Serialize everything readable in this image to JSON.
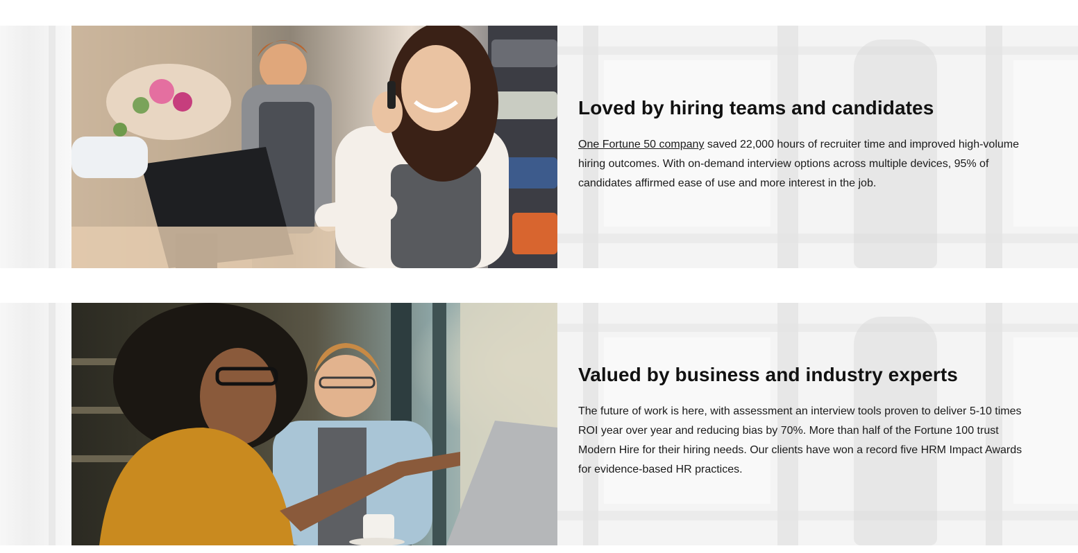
{
  "sections": [
    {
      "heading": "Loved by hiring teams and candidates",
      "link_text": "One Fortune 50 company",
      "body_after_link": " saved 22,000 hours of recruiter time and improved high-volume hiring outcomes. With on-demand interview options across multiple devices, 95% of candidates affirmed ease of use and more interest in the job.",
      "photo_icon": "photo-cashier-on-phone-icon"
    },
    {
      "heading": "Valued by business and industry experts",
      "body": "The future of work is here, with assessment an interview tools proven to deliver 5-10 times ROI year over year and reducing bias by 70%. More than half of the Fortune 100 trust Modern Hire for their hiring needs. Our clients have won a record five HRM Impact Awards for evidence-based HR practices.",
      "photo_icon": "photo-colleagues-at-laptop-icon"
    }
  ],
  "colors": {
    "band_background": "#f4f4f4",
    "text": "#111111",
    "page_background": "#ffffff"
  }
}
